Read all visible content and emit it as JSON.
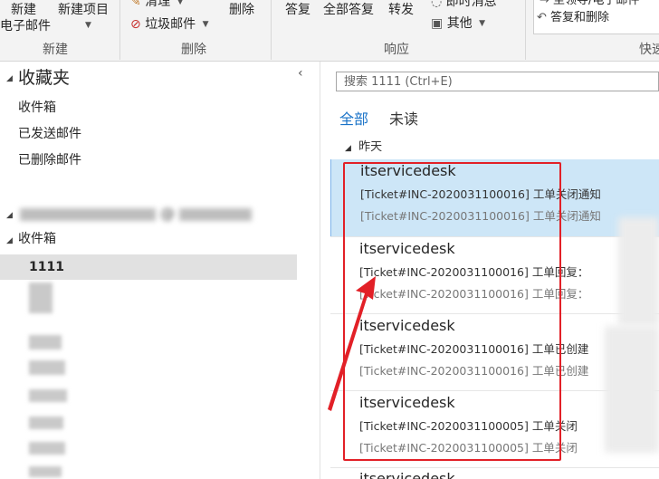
{
  "ribbon": {
    "new_email_label": "新建\n电子邮件",
    "new_email_line1": "新建",
    "new_email_line2": "电子邮件",
    "new_items_label": "新建项目",
    "clean_label": "清理",
    "junk_label": "垃圾邮件",
    "delete_label": "删除",
    "reply_label": "答复",
    "reply_all_label": "全部答复",
    "forward_label": "转发",
    "im_label": "即时消息",
    "more_label": "其他",
    "quick_steps_top": "至领导/电子邮件",
    "reply_delete_label": "答复和删除",
    "groups": {
      "new": "新建",
      "delete": "删除",
      "respond": "响应",
      "quick": "快速"
    }
  },
  "folders": {
    "favorites_title": "收藏夹",
    "favorites": [
      "收件箱",
      "已发送邮件",
      "已删除邮件"
    ],
    "account_blurred": "@",
    "inbox_label": "收件箱",
    "selected_subfolder": "1111"
  },
  "search": {
    "placeholder": "搜索 1111 (Ctrl+E)"
  },
  "filters": {
    "all": "全部",
    "unread": "未读"
  },
  "list": {
    "group_header": "昨天",
    "messages": [
      {
        "sender": "itservicedesk",
        "subject": "[Ticket#INC-2020031100016] 工单关闭通知",
        "preview": "[Ticket#INC-2020031100016] 工单关闭通知"
      },
      {
        "sender": "itservicedesk",
        "subject": "[Ticket#INC-2020031100016] 工单回复：",
        "preview": "[Ticket#INC-2020031100016] 工单回复："
      },
      {
        "sender": "itservicedesk",
        "subject": "[Ticket#INC-2020031100016] 工单已创建",
        "preview": "[Ticket#INC-2020031100016] 工单已创建"
      },
      {
        "sender": "itservicedesk",
        "subject": "[Ticket#INC-2020031100005] 工单关闭",
        "preview": "[Ticket#INC-2020031100005] 工单关闭"
      }
    ],
    "partial_next_sender": "itservicedesk"
  },
  "colors": {
    "accent": "#1a73c8",
    "selection": "#cde6f7",
    "annotation": "#e22027"
  }
}
